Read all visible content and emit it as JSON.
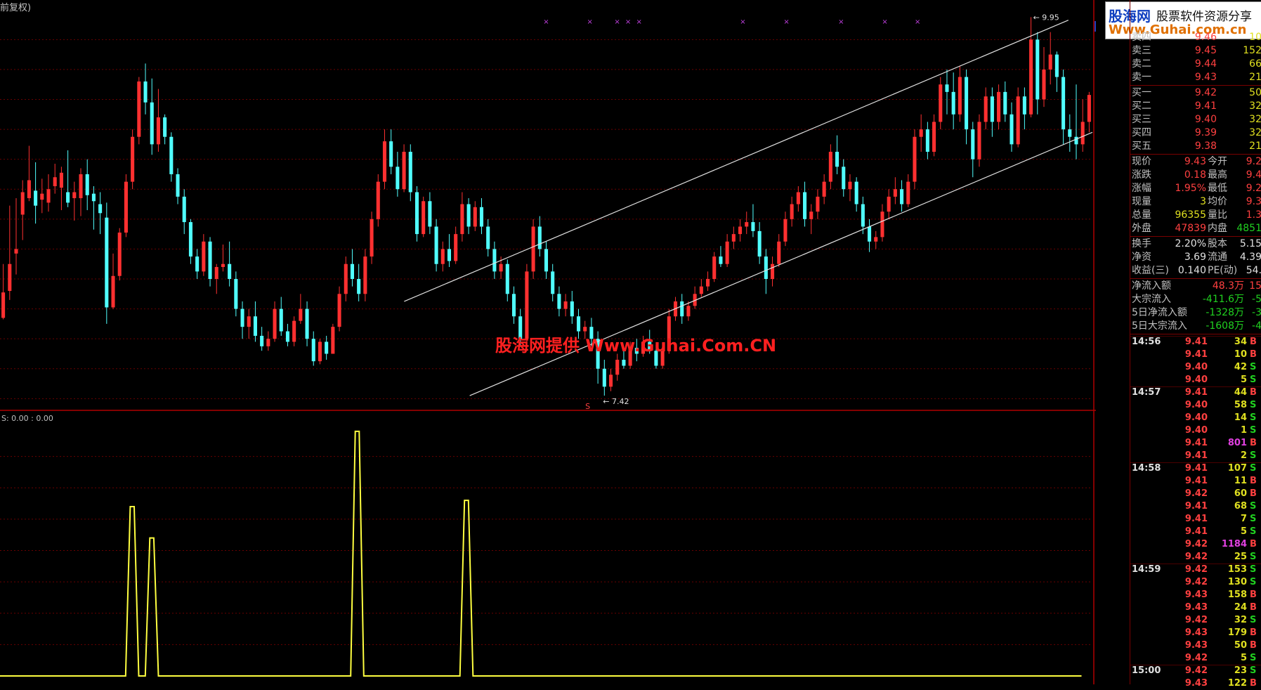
{
  "header": {
    "title": "前复权)"
  },
  "watermark": "股海网提供 Www.Guhai.Com.CN",
  "logo": {
    "brand": "股海网",
    "tagline": "股票软件资源分享",
    "url": "Www.Guhai.com.cn"
  },
  "main_chart": {
    "y_ticks": [
      "9.80",
      "9.60",
      "9.40",
      "9.20",
      "9.00",
      "8.80",
      "8.60",
      "8.40",
      "8.20",
      "8.00",
      "7.80",
      "7.60",
      "7.40"
    ],
    "ymin": 7.35,
    "ymax": 9.98,
    "high_label": "9.95",
    "low_label": "7.42",
    "price_tag": "9.8",
    "marker_s": "S",
    "colors": {
      "up": "#ff3030",
      "down": "#50ffff",
      "channel": "#e0e0e0",
      "grid": "#6a0000"
    },
    "candles": [
      [
        7.94,
        8.3,
        8.11,
        7.93
      ],
      [
        8.12,
        8.69,
        8.3,
        8.06
      ],
      [
        8.37,
        8.74,
        8.4,
        8.23
      ],
      [
        8.63,
        8.86,
        8.78,
        8.46
      ],
      [
        8.74,
        9.09,
        8.86,
        8.72
      ],
      [
        8.79,
        8.98,
        8.69,
        8.57
      ],
      [
        8.73,
        8.87,
        8.77,
        8.64
      ],
      [
        8.71,
        8.9,
        8.8,
        8.65
      ],
      [
        8.82,
        8.97,
        8.88,
        8.77
      ],
      [
        8.81,
        8.95,
        8.91,
        8.66
      ],
      [
        8.78,
        9.06,
        8.71,
        8.68
      ],
      [
        8.74,
        8.85,
        8.78,
        8.59
      ],
      [
        8.74,
        8.94,
        8.9,
        8.62
      ],
      [
        8.9,
        9.0,
        8.76,
        8.66
      ],
      [
        8.77,
        8.82,
        8.72,
        8.53
      ],
      [
        8.7,
        8.78,
        8.64,
        8.5
      ],
      [
        8.61,
        8.71,
        8.01,
        7.9
      ],
      [
        8.01,
        8.37,
        8.22,
        8.0
      ],
      [
        8.22,
        8.54,
        8.51,
        8.19
      ],
      [
        8.51,
        8.9,
        8.85,
        8.48
      ],
      [
        8.85,
        9.2,
        9.15,
        8.8
      ],
      [
        9.15,
        9.55,
        9.52,
        9.1
      ],
      [
        9.52,
        9.64,
        9.38,
        9.3
      ],
      [
        9.38,
        9.54,
        9.1,
        9.03
      ],
      [
        9.1,
        9.47,
        9.28,
        9.05
      ],
      [
        9.28,
        9.3,
        9.15,
        9.1
      ],
      [
        9.15,
        9.18,
        8.9,
        8.85
      ],
      [
        8.9,
        8.94,
        8.75,
        8.7
      ],
      [
        8.75,
        8.8,
        8.58,
        8.5
      ],
      [
        8.58,
        8.6,
        8.35,
        8.3
      ],
      [
        8.35,
        8.4,
        8.25,
        8.2
      ],
      [
        8.25,
        8.5,
        8.45,
        8.22
      ],
      [
        8.45,
        8.48,
        8.2,
        8.15
      ],
      [
        8.2,
        8.3,
        8.28,
        8.1
      ],
      [
        8.28,
        8.43,
        8.3,
        8.25
      ],
      [
        8.3,
        8.45,
        8.2,
        8.15
      ],
      [
        8.2,
        8.25,
        8.0,
        7.95
      ],
      [
        8.0,
        8.05,
        7.88,
        7.8
      ],
      [
        7.88,
        8.0,
        7.95,
        7.8
      ],
      [
        7.95,
        8.05,
        7.82,
        7.78
      ],
      [
        7.82,
        7.88,
        7.75,
        7.72
      ],
      [
        7.75,
        7.85,
        7.8,
        7.72
      ],
      [
        7.8,
        8.05,
        8.0,
        7.78
      ],
      [
        8.0,
        8.08,
        7.85,
        7.82
      ],
      [
        7.85,
        7.9,
        7.78,
        7.75
      ],
      [
        7.78,
        7.95,
        7.92,
        7.75
      ],
      [
        7.92,
        8.1,
        8.0,
        7.9
      ],
      [
        8.0,
        8.05,
        7.8,
        7.75
      ],
      [
        7.8,
        7.85,
        7.65,
        7.62
      ],
      [
        7.65,
        7.8,
        7.78,
        7.63
      ],
      [
        7.78,
        7.82,
        7.7,
        7.66
      ],
      [
        7.7,
        7.9,
        7.88,
        7.7
      ],
      [
        7.88,
        8.15,
        8.1,
        7.85
      ],
      [
        8.1,
        8.35,
        8.3,
        8.05
      ],
      [
        8.3,
        8.4,
        8.2,
        8.15
      ],
      [
        8.2,
        8.3,
        8.1,
        8.05
      ],
      [
        8.1,
        8.4,
        8.35,
        8.05
      ],
      [
        8.35,
        8.65,
        8.6,
        8.3
      ],
      [
        8.6,
        8.9,
        8.85,
        8.55
      ],
      [
        8.85,
        9.2,
        9.12,
        8.8
      ],
      [
        9.12,
        9.2,
        8.95,
        8.9
      ],
      [
        8.95,
        9.05,
        8.8,
        8.75
      ],
      [
        8.8,
        9.1,
        9.05,
        8.78
      ],
      [
        9.05,
        9.1,
        8.78,
        8.72
      ],
      [
        8.78,
        8.82,
        8.5,
        8.45
      ],
      [
        8.5,
        8.75,
        8.72,
        8.48
      ],
      [
        8.72,
        8.78,
        8.55,
        8.5
      ],
      [
        8.55,
        8.6,
        8.3,
        8.25
      ],
      [
        8.3,
        8.45,
        8.4,
        8.25
      ],
      [
        8.4,
        8.5,
        8.32,
        8.28
      ],
      [
        8.32,
        8.55,
        8.5,
        8.3
      ],
      [
        8.5,
        8.78,
        8.7,
        8.45
      ],
      [
        8.7,
        8.74,
        8.55,
        8.5
      ],
      [
        8.55,
        8.72,
        8.68,
        8.52
      ],
      [
        8.68,
        8.74,
        8.55,
        8.5
      ],
      [
        8.55,
        8.6,
        8.4,
        8.35
      ],
      [
        8.4,
        8.45,
        8.25,
        8.2
      ],
      [
        8.25,
        8.35,
        8.3,
        8.2
      ],
      [
        8.3,
        8.33,
        8.1,
        8.05
      ],
      [
        8.1,
        8.15,
        7.95,
        7.9
      ],
      [
        7.95,
        8.0,
        7.8,
        7.75
      ],
      [
        7.8,
        8.3,
        8.25,
        7.78
      ],
      [
        8.25,
        8.6,
        8.55,
        8.2
      ],
      [
        8.55,
        8.62,
        8.4,
        8.35
      ],
      [
        8.4,
        8.45,
        8.25,
        8.2
      ],
      [
        8.25,
        8.3,
        8.1,
        8.05
      ],
      [
        8.1,
        8.15,
        8.0,
        7.95
      ],
      [
        8.0,
        8.1,
        8.05,
        7.95
      ],
      [
        8.05,
        8.12,
        7.95,
        7.9
      ],
      [
        7.95,
        8.0,
        7.85,
        7.8
      ],
      [
        7.85,
        7.92,
        7.88,
        7.8
      ],
      [
        7.88,
        7.94,
        7.8,
        7.75
      ],
      [
        7.8,
        7.85,
        7.6,
        7.5
      ],
      [
        7.6,
        7.66,
        7.48,
        7.42
      ],
      [
        7.48,
        7.6,
        7.56,
        7.45
      ],
      [
        7.56,
        7.7,
        7.66,
        7.52
      ],
      [
        7.66,
        7.75,
        7.62,
        7.6
      ],
      [
        7.62,
        7.78,
        7.74,
        7.6
      ],
      [
        7.74,
        7.8,
        7.7,
        7.65
      ],
      [
        7.7,
        7.82,
        7.78,
        7.68
      ],
      [
        7.78,
        7.86,
        7.72,
        7.7
      ],
      [
        7.72,
        7.76,
        7.62,
        7.6
      ],
      [
        7.62,
        7.75,
        7.72,
        7.6
      ],
      [
        7.72,
        8.0,
        7.95,
        7.7
      ],
      [
        7.95,
        8.08,
        8.05,
        7.92
      ],
      [
        8.05,
        8.1,
        7.95,
        7.9
      ],
      [
        7.95,
        8.05,
        8.02,
        7.92
      ],
      [
        8.02,
        8.15,
        8.1,
        8.0
      ],
      [
        8.1,
        8.2,
        8.15,
        8.08
      ],
      [
        8.15,
        8.25,
        8.2,
        8.12
      ],
      [
        8.2,
        8.38,
        8.35,
        8.18
      ],
      [
        8.35,
        8.42,
        8.3,
        8.28
      ],
      [
        8.3,
        8.5,
        8.45,
        8.28
      ],
      [
        8.45,
        8.55,
        8.5,
        8.4
      ],
      [
        8.5,
        8.6,
        8.55,
        8.45
      ],
      [
        8.55,
        8.65,
        8.58,
        8.5
      ],
      [
        8.58,
        8.7,
        8.52,
        8.48
      ],
      [
        8.52,
        8.58,
        8.35,
        8.3
      ],
      [
        8.35,
        8.4,
        8.2,
        8.1
      ],
      [
        8.2,
        8.35,
        8.3,
        8.15
      ],
      [
        8.3,
        8.5,
        8.45,
        8.28
      ],
      [
        8.45,
        8.65,
        8.6,
        8.42
      ],
      [
        8.6,
        8.75,
        8.7,
        8.55
      ],
      [
        8.7,
        8.82,
        8.78,
        8.65
      ],
      [
        8.78,
        8.85,
        8.6,
        8.55
      ],
      [
        8.6,
        8.7,
        8.65,
        8.5
      ],
      [
        8.65,
        8.8,
        8.75,
        8.6
      ],
      [
        8.75,
        8.9,
        8.85,
        8.7
      ],
      [
        8.85,
        9.1,
        9.05,
        8.8
      ],
      [
        9.05,
        9.16,
        8.95,
        8.9
      ],
      [
        8.95,
        9.0,
        8.8,
        8.75
      ],
      [
        8.8,
        8.9,
        8.85,
        8.72
      ],
      [
        8.85,
        8.88,
        8.7,
        8.65
      ],
      [
        8.7,
        8.75,
        8.55,
        8.5
      ],
      [
        8.55,
        8.6,
        8.45,
        8.38
      ],
      [
        8.45,
        8.52,
        8.48,
        8.4
      ],
      [
        8.48,
        8.7,
        8.65,
        8.45
      ],
      [
        8.65,
        8.8,
        8.75,
        8.6
      ],
      [
        8.75,
        8.88,
        8.8,
        8.7
      ],
      [
        8.8,
        8.86,
        8.7,
        8.65
      ],
      [
        8.7,
        8.9,
        8.85,
        8.68
      ],
      [
        8.85,
        9.2,
        9.15,
        8.8
      ],
      [
        9.15,
        9.3,
        9.2,
        9.05
      ],
      [
        9.2,
        9.25,
        9.05,
        9.0
      ],
      [
        9.05,
        9.3,
        9.25,
        9.02
      ],
      [
        9.25,
        9.55,
        9.5,
        9.2
      ],
      [
        9.5,
        9.6,
        9.45,
        9.3
      ],
      [
        9.45,
        9.58,
        9.3,
        9.2
      ],
      [
        9.3,
        9.62,
        9.55,
        9.25
      ],
      [
        9.55,
        9.6,
        9.2,
        9.1
      ],
      [
        9.2,
        9.25,
        9.0,
        8.88
      ],
      [
        9.0,
        9.3,
        9.25,
        8.95
      ],
      [
        9.25,
        9.48,
        9.42,
        9.2
      ],
      [
        9.42,
        9.48,
        9.25,
        9.15
      ],
      [
        9.25,
        9.5,
        9.45,
        9.2
      ],
      [
        9.45,
        9.52,
        9.3,
        9.25
      ],
      [
        9.3,
        9.38,
        9.1,
        9.05
      ],
      [
        9.1,
        9.48,
        9.42,
        9.08
      ],
      [
        9.42,
        9.48,
        9.3,
        9.2
      ],
      [
        9.3,
        9.95,
        9.8,
        9.28
      ],
      [
        9.8,
        9.85,
        9.4,
        9.3
      ],
      [
        9.4,
        9.75,
        9.6,
        9.35
      ],
      [
        9.6,
        9.85,
        9.7,
        9.5
      ],
      [
        9.7,
        9.72,
        9.55,
        9.45
      ],
      [
        9.55,
        9.6,
        9.2,
        9.1
      ],
      [
        9.2,
        9.3,
        9.15,
        9.05
      ],
      [
        9.15,
        9.5,
        9.1,
        9.0
      ],
      [
        9.1,
        9.4,
        9.25,
        9.05
      ],
      [
        9.25,
        9.45,
        9.43,
        9.18
      ]
    ],
    "channel_upper": [
      [
        0.37,
        8.05
      ],
      [
        0.978,
        9.93
      ]
    ],
    "channel_lower": [
      [
        0.43,
        7.42
      ],
      [
        1.0,
        9.18
      ]
    ],
    "x_markers": [
      0.5,
      0.54,
      0.565,
      0.575,
      0.585,
      0.68,
      0.72,
      0.77,
      0.81,
      0.84
    ]
  },
  "sub_chart": {
    "label": "S: 0.00 : 0.00",
    "y_ticks": [
      "35.00",
      "30.00",
      "25.00",
      "20.00",
      "15.00",
      "10.00",
      "5.00"
    ],
    "ymax": 40,
    "color": "#ffff40",
    "spikes": [
      [
        0.121,
        27
      ],
      [
        0.139,
        22
      ],
      [
        0.327,
        39
      ],
      [
        0.427,
        28
      ]
    ]
  },
  "quotes": {
    "sell": [
      {
        "label": "卖四",
        "price": "9.46",
        "vol": "10"
      },
      {
        "label": "卖三",
        "price": "9.45",
        "vol": "152"
      },
      {
        "label": "卖二",
        "price": "9.44",
        "vol": "66"
      },
      {
        "label": "卖一",
        "price": "9.43",
        "vol": "21"
      }
    ],
    "buy": [
      {
        "label": "买一",
        "price": "9.42",
        "vol": "50"
      },
      {
        "label": "买二",
        "price": "9.41",
        "vol": "32"
      },
      {
        "label": "买三",
        "price": "9.40",
        "vol": "32"
      },
      {
        "label": "买四",
        "price": "9.39",
        "vol": "32"
      },
      {
        "label": "买五",
        "price": "9.38",
        "vol": "21"
      }
    ],
    "stats": [
      {
        "l1": "现价",
        "v1": "9.43",
        "c1": "red",
        "l2": "今开",
        "v2": "9.2",
        "c2": "red"
      },
      {
        "l1": "涨跌",
        "v1": "0.18",
        "c1": "red",
        "l2": "最高",
        "v2": "9.4",
        "c2": "red"
      },
      {
        "l1": "涨幅",
        "v1": "1.95%",
        "c1": "red",
        "l2": "最低",
        "v2": "9.2",
        "c2": "red"
      },
      {
        "l1": "现量",
        "v1": "3",
        "c1": "yellow",
        "l2": "均价",
        "v2": "9.3",
        "c2": "red"
      },
      {
        "l1": "总量",
        "v1": "96355",
        "c1": "yellow",
        "l2": "量比",
        "v2": "1.3",
        "c2": "red"
      },
      {
        "l1": "外盘",
        "v1": "47839",
        "c1": "red",
        "l2": "内盘",
        "v2": "4851",
        "c2": "green"
      }
    ],
    "stats2": [
      {
        "l1": "换手",
        "v1": "2.20%",
        "l2": "股本",
        "v2": "5.15"
      },
      {
        "l1": "净资",
        "v1": "3.69",
        "l2": "流通",
        "v2": "4.39"
      },
      {
        "l1": "收益(三)",
        "v1": "0.140",
        "l2": "PE(动)",
        "v2": "54."
      }
    ],
    "flows": [
      {
        "label": "净流入额",
        "v1": "48.3万",
        "c1": "red",
        "v2": "15",
        "c2": "red"
      },
      {
        "label": "大宗流入",
        "v1": "-411.6万",
        "c1": "green",
        "v2": "-5",
        "c2": "green"
      },
      {
        "label": "5日净流入额",
        "v1": "-1328万",
        "c1": "green",
        "v2": "-3",
        "c2": "green"
      },
      {
        "label": "5日大宗流入",
        "v1": "-1608万",
        "c1": "green",
        "v2": "-4",
        "c2": "green"
      }
    ]
  },
  "ticks": [
    {
      "time": "14:56",
      "price": "9.41",
      "vol": "34",
      "bs": "B",
      "vc": "yellow"
    },
    {
      "time": "",
      "price": "9.41",
      "vol": "10",
      "bs": "B",
      "vc": "yellow"
    },
    {
      "time": "",
      "price": "9.40",
      "vol": "42",
      "bs": "S",
      "vc": "yellow"
    },
    {
      "time": "",
      "price": "9.40",
      "vol": "5",
      "bs": "S",
      "vc": "yellow"
    },
    {
      "time": "14:57",
      "price": "9.41",
      "vol": "44",
      "bs": "B",
      "vc": "yellow"
    },
    {
      "time": "",
      "price": "9.40",
      "vol": "58",
      "bs": "S",
      "vc": "yellow"
    },
    {
      "time": "",
      "price": "9.40",
      "vol": "14",
      "bs": "S",
      "vc": "yellow"
    },
    {
      "time": "",
      "price": "9.40",
      "vol": "1",
      "bs": "S",
      "vc": "yellow"
    },
    {
      "time": "",
      "price": "9.41",
      "vol": "801",
      "bs": "B",
      "vc": "mag"
    },
    {
      "time": "",
      "price": "9.41",
      "vol": "2",
      "bs": "S",
      "vc": "yellow"
    },
    {
      "time": "14:58",
      "price": "9.41",
      "vol": "107",
      "bs": "S",
      "vc": "yellow"
    },
    {
      "time": "",
      "price": "9.41",
      "vol": "11",
      "bs": "B",
      "vc": "yellow"
    },
    {
      "time": "",
      "price": "9.42",
      "vol": "60",
      "bs": "B",
      "vc": "yellow"
    },
    {
      "time": "",
      "price": "9.41",
      "vol": "68",
      "bs": "S",
      "vc": "yellow"
    },
    {
      "time": "",
      "price": "9.41",
      "vol": "7",
      "bs": "S",
      "vc": "yellow"
    },
    {
      "time": "",
      "price": "9.41",
      "vol": "5",
      "bs": "S",
      "vc": "yellow"
    },
    {
      "time": "",
      "price": "9.42",
      "vol": "1184",
      "bs": "B",
      "vc": "mag"
    },
    {
      "time": "",
      "price": "9.42",
      "vol": "25",
      "bs": "S",
      "vc": "yellow"
    },
    {
      "time": "14:59",
      "price": "9.42",
      "vol": "153",
      "bs": "S",
      "vc": "yellow"
    },
    {
      "time": "",
      "price": "9.42",
      "vol": "130",
      "bs": "S",
      "vc": "yellow"
    },
    {
      "time": "",
      "price": "9.43",
      "vol": "158",
      "bs": "B",
      "vc": "yellow"
    },
    {
      "time": "",
      "price": "9.43",
      "vol": "24",
      "bs": "B",
      "vc": "yellow"
    },
    {
      "time": "",
      "price": "9.42",
      "vol": "32",
      "bs": "S",
      "vc": "yellow"
    },
    {
      "time": "",
      "price": "9.43",
      "vol": "179",
      "bs": "B",
      "vc": "yellow"
    },
    {
      "time": "",
      "price": "9.43",
      "vol": "50",
      "bs": "B",
      "vc": "yellow"
    },
    {
      "time": "",
      "price": "9.42",
      "vol": "5",
      "bs": "S",
      "vc": "yellow"
    },
    {
      "time": "15:00",
      "price": "9.42",
      "vol": "23",
      "bs": "S",
      "vc": "yellow"
    },
    {
      "time": "",
      "price": "9.43",
      "vol": "122",
      "bs": "B",
      "vc": "yellow"
    }
  ]
}
